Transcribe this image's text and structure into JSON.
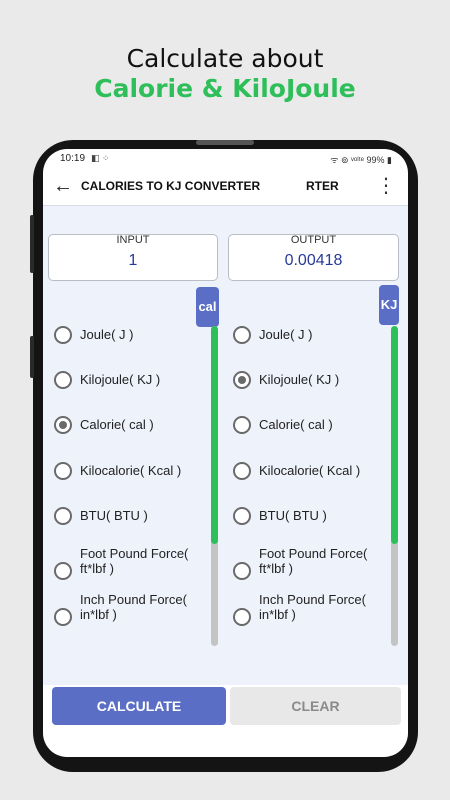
{
  "promo": {
    "line1": "Calculate about",
    "line2": "Calorie & KiloJoule",
    "accent_color": "#2fbf5a"
  },
  "status": {
    "time": "10:19",
    "small_icons": "◧ ⁘",
    "right": "ᯤ ⊚ ᵛᵒˡᵗᵉ 99% ▮",
    "battery": "99%"
  },
  "appbar": {
    "back_icon": "arrow-left",
    "title": "CALORIES TO KJ CONVERTER",
    "title_overflow": "RTER",
    "menu_icon": "more-vertical"
  },
  "input": {
    "label": "INPUT",
    "value": "1"
  },
  "output": {
    "label": "OUTPUT",
    "value": "0.00418"
  },
  "from_unit_badge": "cal",
  "to_unit_badge": "KJ",
  "units": [
    {
      "label": "Joule( J )"
    },
    {
      "label": "Kilojoule( KJ )"
    },
    {
      "label": "Calorie( cal )"
    },
    {
      "label": "Kilocalorie( Kcal )"
    },
    {
      "label": "BTU( BTU )"
    },
    {
      "label": "Foot Pound Force( ft*lbf )"
    },
    {
      "label": "Inch Pound Force( in*lbf )"
    }
  ],
  "from_selected": "Calorie( cal )",
  "to_selected": "Kilojoule( KJ )",
  "scroll_position": 0.68,
  "buttons": {
    "calculate": "CALCULATE",
    "clear": "CLEAR"
  },
  "colors": {
    "primary": "#5a6ec6",
    "value_text": "#283a99",
    "scroll_thumb": "#2fbf5a"
  }
}
